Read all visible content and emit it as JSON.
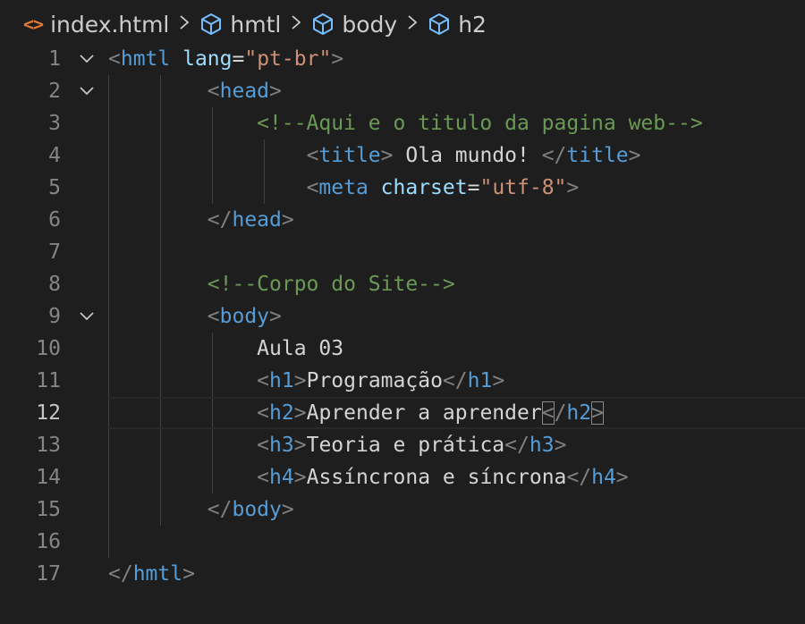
{
  "breadcrumb": {
    "items": [
      {
        "label": "index.html",
        "icon": "html-file-icon"
      },
      {
        "label": "hmtl",
        "icon": "cube-icon"
      },
      {
        "label": "body",
        "icon": "cube-icon"
      },
      {
        "label": "h2",
        "icon": "cube-icon"
      }
    ],
    "separator": ">"
  },
  "editor": {
    "current_line": 12,
    "lines": [
      {
        "n": "1",
        "fold": true,
        "tokens": [
          {
            "c": "t-punct",
            "t": "<"
          },
          {
            "c": "t-tag",
            "t": "hmtl"
          },
          {
            "c": "t-text",
            "t": " "
          },
          {
            "c": "t-attr",
            "t": "lang"
          },
          {
            "c": "t-eq",
            "t": "="
          },
          {
            "c": "t-str",
            "t": "\"pt-br\""
          },
          {
            "c": "t-punct",
            "t": ">"
          }
        ]
      },
      {
        "n": "2",
        "fold": true,
        "tokens": [
          {
            "c": "t-text",
            "t": "        "
          },
          {
            "c": "t-punct",
            "t": "<"
          },
          {
            "c": "t-tag",
            "t": "head"
          },
          {
            "c": "t-punct",
            "t": ">"
          }
        ]
      },
      {
        "n": "3",
        "fold": false,
        "tokens": [
          {
            "c": "t-text",
            "t": "            "
          },
          {
            "c": "t-comment",
            "t": "<!--Aqui e o titulo da pagina web-->"
          }
        ]
      },
      {
        "n": "4",
        "fold": false,
        "tokens": [
          {
            "c": "t-text",
            "t": "                "
          },
          {
            "c": "t-punct",
            "t": "<"
          },
          {
            "c": "t-tag",
            "t": "title"
          },
          {
            "c": "t-punct",
            "t": ">"
          },
          {
            "c": "t-text",
            "t": " Ola mundo! "
          },
          {
            "c": "t-punct",
            "t": "</"
          },
          {
            "c": "t-tag",
            "t": "title"
          },
          {
            "c": "t-punct",
            "t": ">"
          }
        ]
      },
      {
        "n": "5",
        "fold": false,
        "tokens": [
          {
            "c": "t-text",
            "t": "                "
          },
          {
            "c": "t-punct",
            "t": "<"
          },
          {
            "c": "t-tag",
            "t": "meta"
          },
          {
            "c": "t-text",
            "t": " "
          },
          {
            "c": "t-attr",
            "t": "charset"
          },
          {
            "c": "t-eq",
            "t": "="
          },
          {
            "c": "t-str",
            "t": "\"utf-8\""
          },
          {
            "c": "t-punct",
            "t": ">"
          }
        ]
      },
      {
        "n": "6",
        "fold": false,
        "tokens": [
          {
            "c": "t-text",
            "t": "        "
          },
          {
            "c": "t-punct",
            "t": "</"
          },
          {
            "c": "t-tag",
            "t": "head"
          },
          {
            "c": "t-punct",
            "t": ">"
          }
        ]
      },
      {
        "n": "7",
        "fold": false,
        "tokens": []
      },
      {
        "n": "8",
        "fold": false,
        "tokens": [
          {
            "c": "t-text",
            "t": "        "
          },
          {
            "c": "t-comment",
            "t": "<!--Corpo do Site-->"
          }
        ]
      },
      {
        "n": "9",
        "fold": true,
        "tokens": [
          {
            "c": "t-text",
            "t": "        "
          },
          {
            "c": "t-punct",
            "t": "<"
          },
          {
            "c": "t-tag",
            "t": "body"
          },
          {
            "c": "t-punct",
            "t": ">"
          }
        ]
      },
      {
        "n": "10",
        "fold": false,
        "tokens": [
          {
            "c": "t-text",
            "t": "            Aula 03"
          }
        ]
      },
      {
        "n": "11",
        "fold": false,
        "tokens": [
          {
            "c": "t-text",
            "t": "            "
          },
          {
            "c": "t-punct",
            "t": "<"
          },
          {
            "c": "t-tag",
            "t": "h1"
          },
          {
            "c": "t-punct",
            "t": ">"
          },
          {
            "c": "t-text",
            "t": "Programação"
          },
          {
            "c": "t-punct",
            "t": "</"
          },
          {
            "c": "t-tag",
            "t": "h1"
          },
          {
            "c": "t-punct",
            "t": ">"
          }
        ]
      },
      {
        "n": "12",
        "fold": false,
        "tokens": [
          {
            "c": "t-text",
            "t": "            "
          },
          {
            "c": "t-punct",
            "t": "<"
          },
          {
            "c": "t-tag",
            "t": "h2"
          },
          {
            "c": "t-punct",
            "t": ">"
          },
          {
            "c": "t-text",
            "t": "Aprender a aprender"
          },
          {
            "c": "t-punct bracket-box",
            "t": "<"
          },
          {
            "c": "t-punct",
            "t": "/"
          },
          {
            "c": "t-tag",
            "t": "h2"
          },
          {
            "c": "t-punct bracket-box",
            "t": ">"
          }
        ]
      },
      {
        "n": "13",
        "fold": false,
        "tokens": [
          {
            "c": "t-text",
            "t": "            "
          },
          {
            "c": "t-punct",
            "t": "<"
          },
          {
            "c": "t-tag",
            "t": "h3"
          },
          {
            "c": "t-punct",
            "t": ">"
          },
          {
            "c": "t-text",
            "t": "Teoria e prática"
          },
          {
            "c": "t-punct",
            "t": "</"
          },
          {
            "c": "t-tag",
            "t": "h3"
          },
          {
            "c": "t-punct",
            "t": ">"
          }
        ]
      },
      {
        "n": "14",
        "fold": false,
        "tokens": [
          {
            "c": "t-text",
            "t": "            "
          },
          {
            "c": "t-punct",
            "t": "<"
          },
          {
            "c": "t-tag",
            "t": "h4"
          },
          {
            "c": "t-punct",
            "t": ">"
          },
          {
            "c": "t-text",
            "t": "Assíncrona e síncrona"
          },
          {
            "c": "t-punct",
            "t": "</"
          },
          {
            "c": "t-tag",
            "t": "h4"
          },
          {
            "c": "t-punct",
            "t": ">"
          }
        ]
      },
      {
        "n": "15",
        "fold": false,
        "tokens": [
          {
            "c": "t-text",
            "t": "        "
          },
          {
            "c": "t-punct",
            "t": "</"
          },
          {
            "c": "t-tag",
            "t": "body"
          },
          {
            "c": "t-punct",
            "t": ">"
          }
        ]
      },
      {
        "n": "16",
        "fold": false,
        "tokens": []
      },
      {
        "n": "17",
        "fold": false,
        "tokens": [
          {
            "c": "t-punct",
            "t": "</"
          },
          {
            "c": "t-tag",
            "t": "hmtl"
          },
          {
            "c": "t-punct",
            "t": ">"
          }
        ]
      }
    ]
  },
  "colors": {
    "background": "#1e1e1e",
    "tag": "#569cd6",
    "attribute": "#9cdcfe",
    "string": "#ce9178",
    "comment": "#6a9955",
    "text": "#d4d4d4",
    "punctuation": "#808080",
    "line_number": "#858585",
    "file_icon": "#e37933"
  }
}
